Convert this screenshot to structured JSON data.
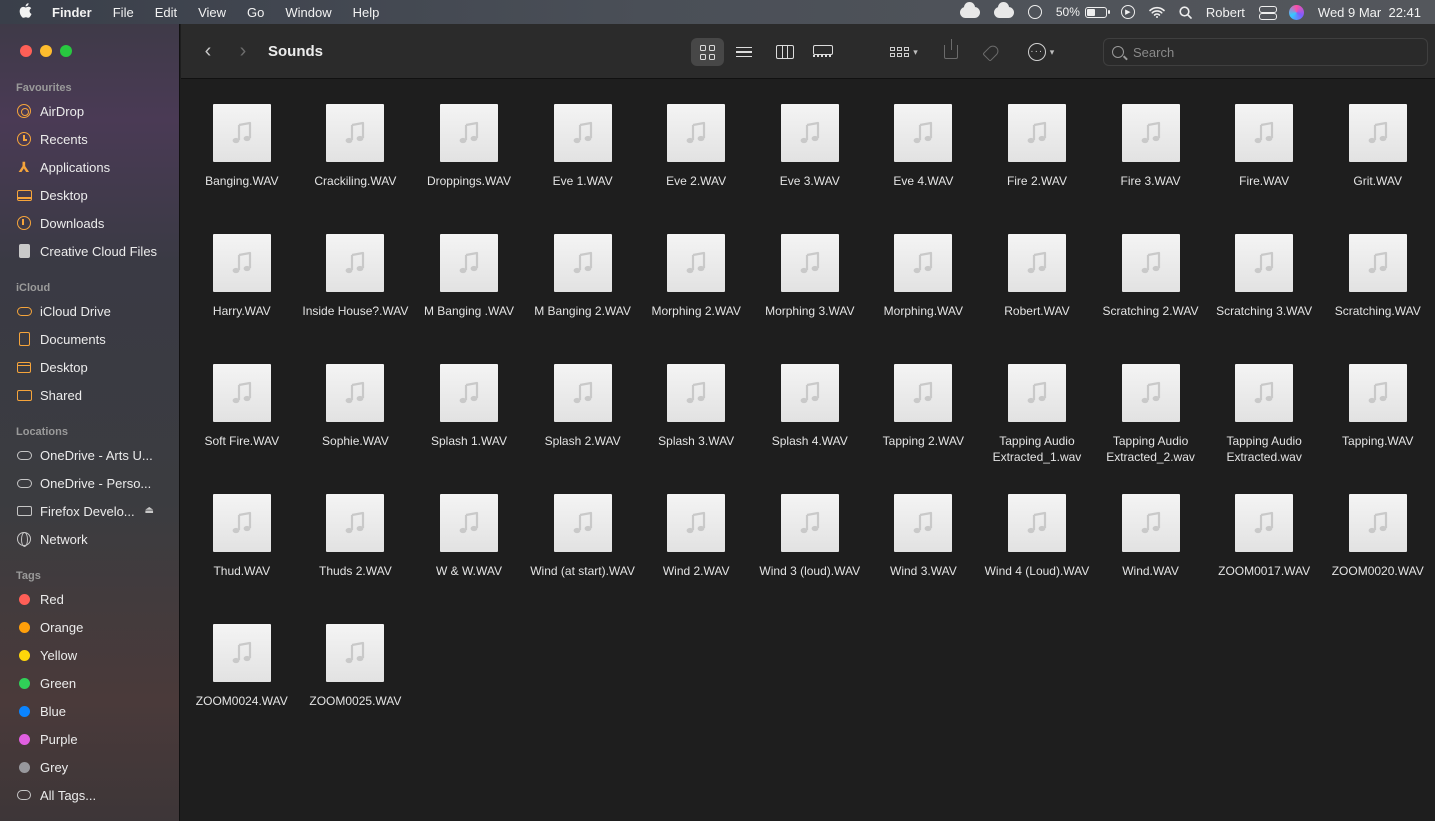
{
  "menubar": {
    "app_name": "Finder",
    "menus": [
      "File",
      "Edit",
      "View",
      "Go",
      "Window",
      "Help"
    ],
    "battery": "50%",
    "user": "Robert",
    "datetime": "Wed 9 Mar  22:41"
  },
  "window": {
    "title": "Sounds",
    "search_placeholder": "Search"
  },
  "sidebar": {
    "favourites_header": "Favourites",
    "favourites": [
      {
        "label": "AirDrop",
        "icon": "airdrop-icon"
      },
      {
        "label": "Recents",
        "icon": "clock-icon"
      },
      {
        "label": "Applications",
        "icon": "applications-icon"
      },
      {
        "label": "Desktop",
        "icon": "desktop-icon"
      },
      {
        "label": "Downloads",
        "icon": "downloads-icon"
      },
      {
        "label": "Creative Cloud Files",
        "icon": "document-icon"
      }
    ],
    "icloud_header": "iCloud",
    "icloud": [
      {
        "label": "iCloud Drive",
        "icon": "cloud-icon"
      },
      {
        "label": "Documents",
        "icon": "document-icon"
      },
      {
        "label": "Desktop",
        "icon": "folder-icon"
      },
      {
        "label": "Shared",
        "icon": "shared-folder-icon"
      }
    ],
    "locations_header": "Locations",
    "locations": [
      {
        "label": "OneDrive - Arts U...",
        "icon": "cloud-icon"
      },
      {
        "label": "OneDrive - Perso...",
        "icon": "cloud-icon"
      },
      {
        "label": "Firefox Develo...",
        "icon": "drive-icon"
      },
      {
        "label": "Network",
        "icon": "globe-icon"
      }
    ],
    "tags_header": "Tags",
    "tags": [
      {
        "label": "Red",
        "color": "#ff5f57"
      },
      {
        "label": "Orange",
        "color": "#ff9f0a"
      },
      {
        "label": "Yellow",
        "color": "#ffd60a"
      },
      {
        "label": "Green",
        "color": "#30d158"
      },
      {
        "label": "Blue",
        "color": "#0a84ff"
      },
      {
        "label": "Purple",
        "color": "#e05fe0"
      },
      {
        "label": "Grey",
        "color": "#98989d"
      }
    ],
    "all_tags": "All Tags..."
  },
  "files": [
    "Banging.WAV",
    "Crackiling.WAV",
    "Droppings.WAV",
    "Eve 1.WAV",
    "Eve 2.WAV",
    "Eve 3.WAV",
    "Eve 4.WAV",
    "Fire 2.WAV",
    "Fire 3.WAV",
    "Fire.WAV",
    "Grit.WAV",
    "Harry.WAV",
    "Inside House?.WAV",
    "M Banging .WAV",
    "M Banging 2.WAV",
    "Morphing 2.WAV",
    "Morphing 3.WAV",
    "Morphing.WAV",
    "Robert.WAV",
    "Scratching 2.WAV",
    "Scratching 3.WAV",
    "Scratching.WAV",
    "Soft Fire.WAV",
    "Sophie.WAV",
    "Splash 1.WAV",
    "Splash 2.WAV",
    "Splash 3.WAV",
    "Splash 4.WAV",
    "Tapping 2.WAV",
    "Tapping Audio Extracted_1.wav",
    "Tapping Audio Extracted_2.wav",
    "Tapping Audio Extracted.wav",
    "Tapping.WAV",
    "Thud.WAV",
    "Thuds 2.WAV",
    "W & W.WAV",
    "Wind (at start).WAV",
    "Wind 2.WAV",
    "Wind 3 (loud).WAV",
    "Wind 3.WAV",
    "Wind 4 (Loud).WAV",
    "Wind.WAV",
    "ZOOM0017.WAV",
    "ZOOM0020.WAV",
    "ZOOM0024.WAV",
    "ZOOM0025.WAV"
  ]
}
